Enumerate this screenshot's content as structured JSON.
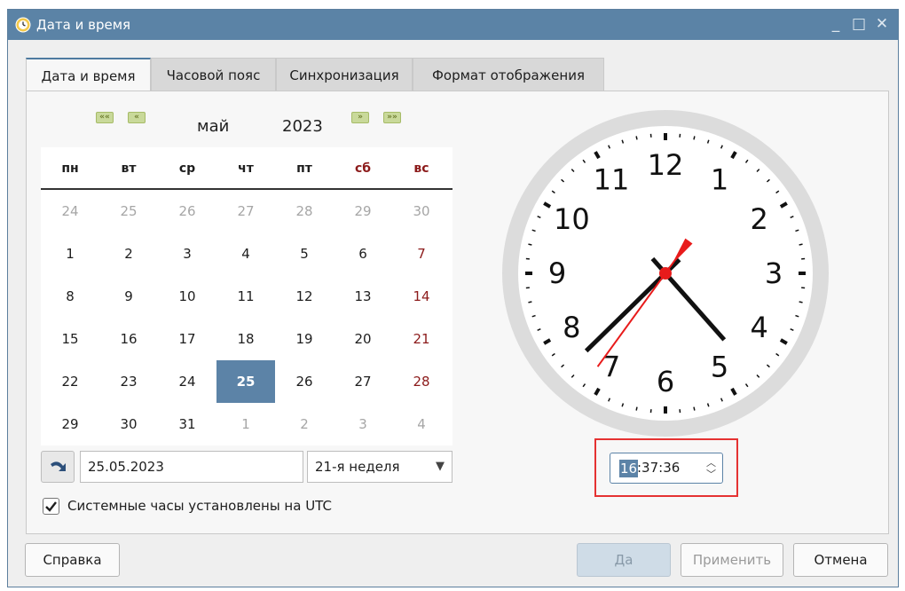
{
  "window": {
    "title": "Дата и время",
    "minimize_glyph": "_",
    "maximize_glyph": "□",
    "close_glyph": "✕",
    "icon": "clock-app-icon"
  },
  "tabs": [
    {
      "label": "Дата и время",
      "active": true
    },
    {
      "label": "Часовой пояс",
      "active": false
    },
    {
      "label": "Синхронизация",
      "active": false
    },
    {
      "label": "Формат отображения",
      "active": false
    }
  ],
  "calendar": {
    "nav": {
      "prev_year": "««",
      "prev_month": "«",
      "next_month": "»",
      "next_year": "»»"
    },
    "month": "май",
    "year": "2023",
    "weekdays": [
      "пн",
      "вт",
      "ср",
      "чт",
      "пт",
      "сб",
      "вс"
    ],
    "weeks": [
      [
        "24",
        "25",
        "26",
        "27",
        "28",
        "29",
        "30"
      ],
      [
        "1",
        "2",
        "3",
        "4",
        "5",
        "6",
        "7"
      ],
      [
        "8",
        "9",
        "10",
        "11",
        "12",
        "13",
        "14"
      ],
      [
        "15",
        "16",
        "17",
        "18",
        "19",
        "20",
        "21"
      ],
      [
        "22",
        "23",
        "24",
        "25",
        "26",
        "27",
        "28"
      ],
      [
        "29",
        "30",
        "31",
        "1",
        "2",
        "3",
        "4"
      ]
    ],
    "selected_day": "25",
    "date_value": "25.05.2023",
    "week_value": "21-я неделя",
    "utc_checked": true,
    "utc_label": "Системные часы установлены на UTC"
  },
  "clock": {
    "numbers": [
      "12",
      "1",
      "2",
      "3",
      "4",
      "5",
      "6",
      "7",
      "8",
      "9",
      "10",
      "11"
    ],
    "time_hours": "16",
    "time_rest": ":37:36",
    "hands": {
      "hour": 16,
      "minute": 37,
      "second": 36
    },
    "colors": {
      "hands": "#111111",
      "second_hand": "#e81b1b",
      "ring": "#dcdcdc"
    }
  },
  "buttons": {
    "help": "Справка",
    "ok": "Да",
    "apply": "Применить",
    "cancel": "Отмена"
  },
  "colors": {
    "accent": "#5c83a7",
    "titlebar": "#5b83a6",
    "weekend": "#8c1b1b",
    "highlight_frame": "#e53232"
  }
}
